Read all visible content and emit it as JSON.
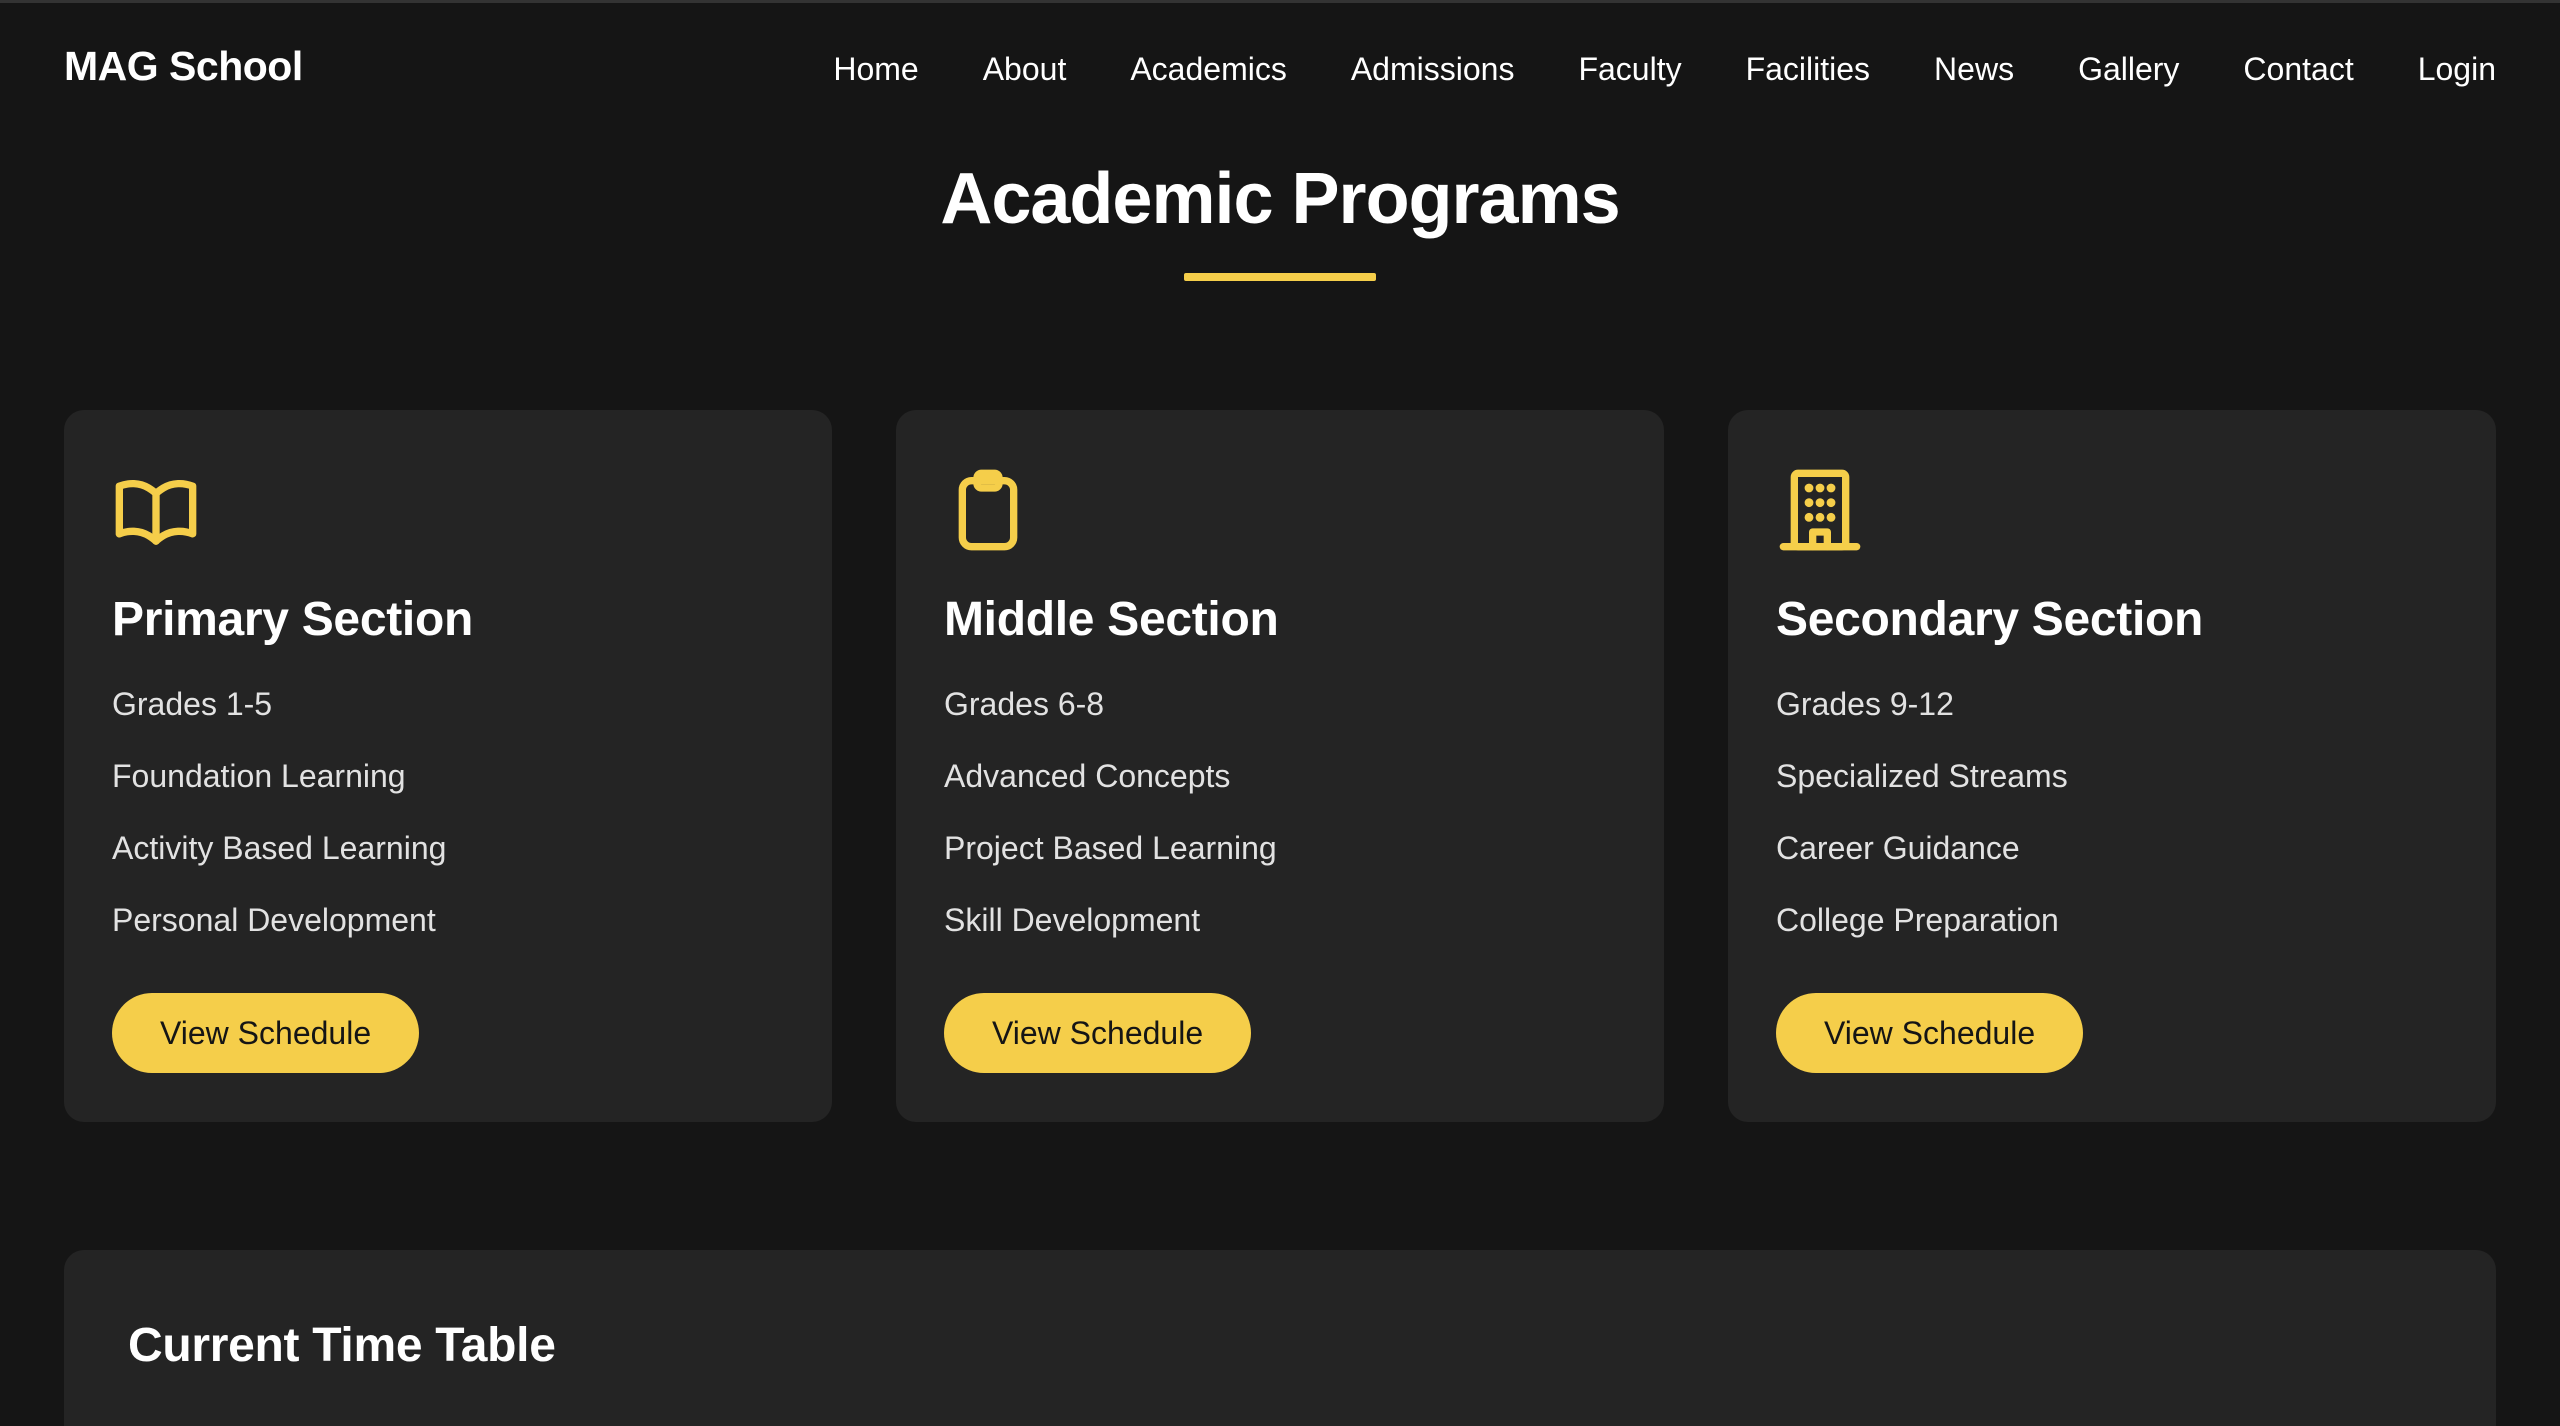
{
  "brand": "MAG School",
  "nav": [
    "Home",
    "About",
    "Academics",
    "Admissions",
    "Faculty",
    "Facilities",
    "News",
    "Gallery",
    "Contact",
    "Login"
  ],
  "section_title": "Academic Programs",
  "accent_color": "#f5ce4a",
  "cards": [
    {
      "icon": "book-open-icon",
      "title": "Primary Section",
      "items": [
        "Grades 1-5",
        "Foundation Learning",
        "Activity Based Learning",
        "Personal Development"
      ],
      "button": "View Schedule"
    },
    {
      "icon": "clipboard-icon",
      "title": "Middle Section",
      "items": [
        "Grades 6-8",
        "Advanced Concepts",
        "Project Based Learning",
        "Skill Development"
      ],
      "button": "View Schedule"
    },
    {
      "icon": "building-icon",
      "title": "Secondary Section",
      "items": [
        "Grades 9-12",
        "Specialized Streams",
        "Career Guidance",
        "College Preparation"
      ],
      "button": "View Schedule"
    }
  ],
  "timetable": {
    "title": "Current Time Table"
  }
}
